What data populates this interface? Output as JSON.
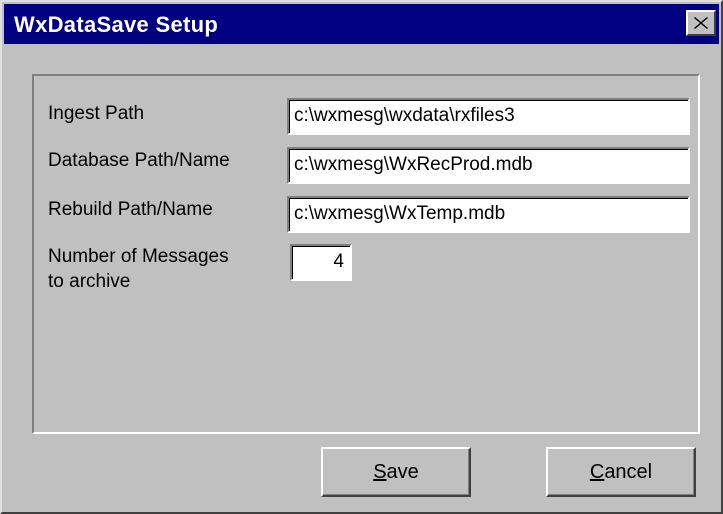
{
  "window": {
    "title": "WxDataSave Setup",
    "close_icon": "close-icon"
  },
  "form": {
    "ingest_label": "Ingest Path",
    "ingest_value": "c:\\wxmesg\\wxdata\\rxfiles3",
    "database_label": "Database Path/Name",
    "database_value": "c:\\wxmesg\\WxRecProd.mdb",
    "rebuild_label": "Rebuild Path/Name",
    "rebuild_value": "c:\\wxmesg\\WxTemp.mdb",
    "messages_label_line1": "Number of Messages",
    "messages_label_line2": "to archive",
    "messages_value": "4"
  },
  "buttons": {
    "save_mnemonic": "S",
    "save_rest": "ave",
    "cancel_mnemonic": "C",
    "cancel_rest": "ancel"
  },
  "colors": {
    "titlebar": "#000080",
    "face": "#c0c0c0"
  }
}
